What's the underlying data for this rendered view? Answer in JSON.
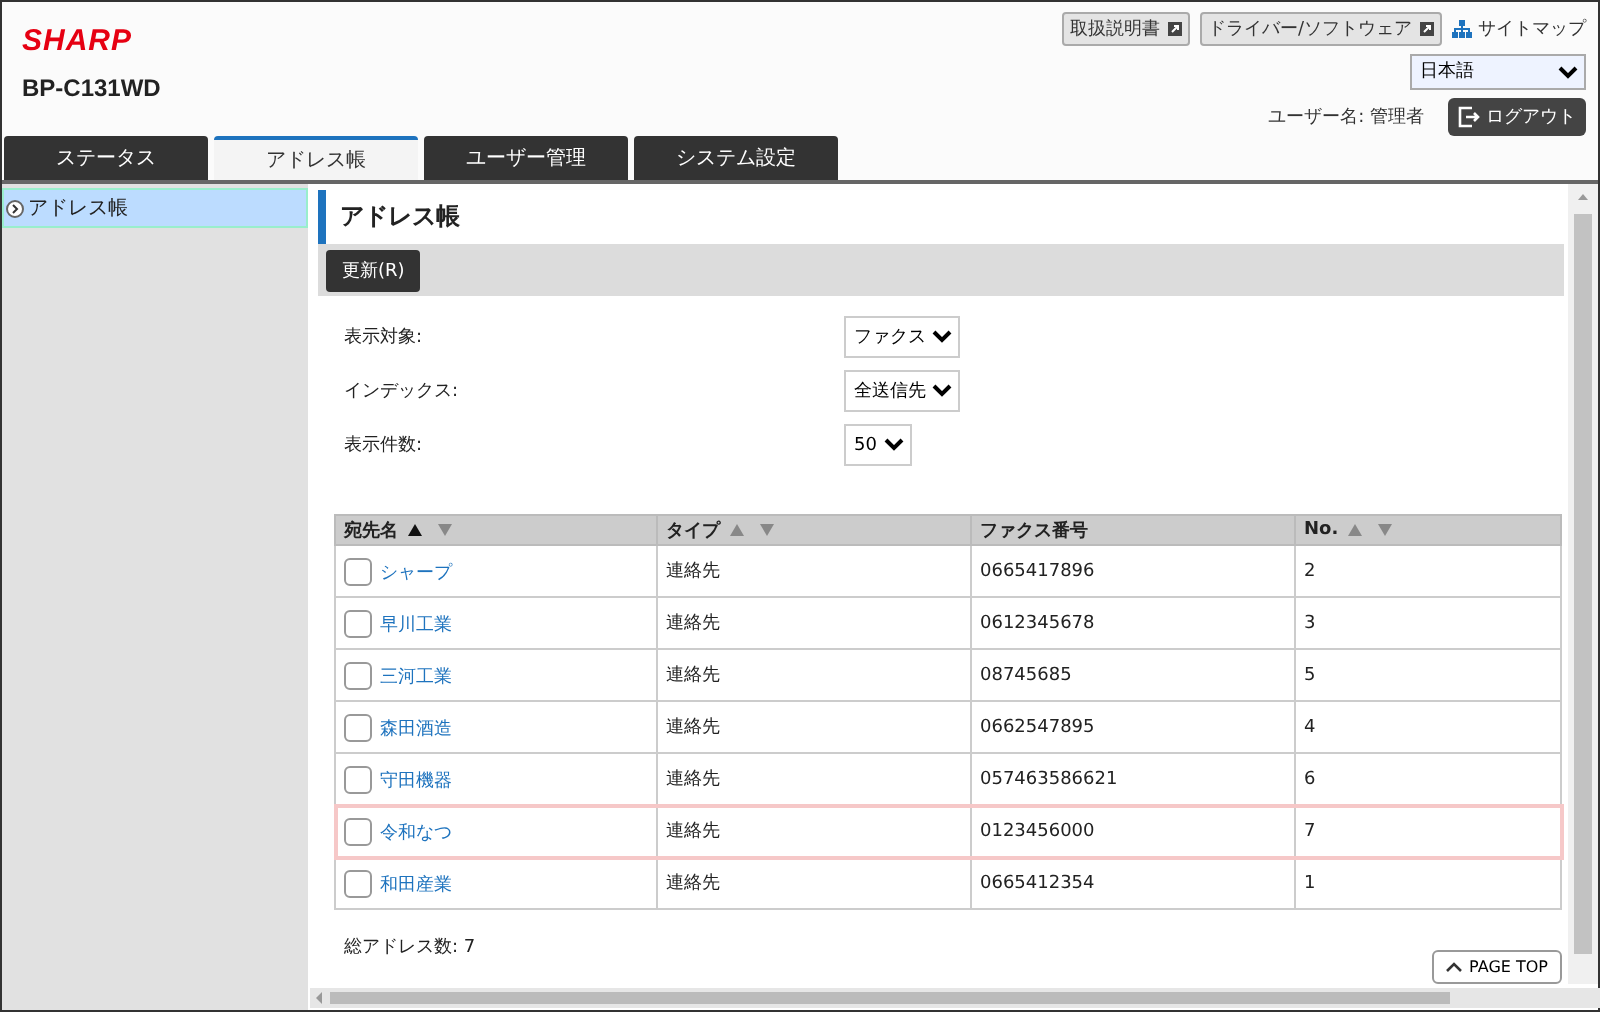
{
  "header": {
    "logo": "SHARP",
    "model": "BP-C131WD",
    "links": [
      {
        "label": "取扱説明書",
        "kind": "external"
      },
      {
        "label": "ドライバー/ソフトウェア",
        "kind": "external"
      },
      {
        "label": "サイトマップ",
        "kind": "sitemap"
      }
    ],
    "language": "日本語",
    "user_label": "ユーザー名: 管理者",
    "logout": "ログアウト"
  },
  "tabs": [
    {
      "label": "ステータス",
      "selected": false
    },
    {
      "label": "アドレス帳",
      "selected": true
    },
    {
      "label": "ユーザー管理",
      "selected": false
    },
    {
      "label": "システム設定",
      "selected": false
    }
  ],
  "sidebar": {
    "items": [
      {
        "label": "アドレス帳",
        "selected": true
      }
    ]
  },
  "page_title": "アドレス帳",
  "toolbar": {
    "buttons": [
      "更新(R)"
    ]
  },
  "filters": [
    {
      "label": "表示対象:",
      "value": "ファクス"
    },
    {
      "label": "インデックス:",
      "value": "全送信先"
    },
    {
      "label": "表示件数:",
      "value": "50"
    }
  ],
  "table": {
    "columns": [
      {
        "label": "宛先名",
        "sortable": true,
        "sorted_ascending": true
      },
      {
        "label": "タイプ",
        "sortable": true,
        "sorted_ascending": false
      },
      {
        "label": "ファクス番号",
        "sortable": false
      },
      {
        "label": "No.",
        "sortable": true,
        "sorted_ascending": false
      }
    ],
    "rows": [
      {
        "name": "シャープ",
        "type": "連絡先",
        "fax": "0665417896",
        "no": "2",
        "checked": false,
        "highlighted": false
      },
      {
        "name": "早川工業",
        "type": "連絡先",
        "fax": "0612345678",
        "no": "3",
        "checked": false,
        "highlighted": false
      },
      {
        "name": "三河工業",
        "type": "連絡先",
        "fax": "08745685",
        "no": "5",
        "checked": false,
        "highlighted": false
      },
      {
        "name": "森田酒造",
        "type": "連絡先",
        "fax": "0662547895",
        "no": "4",
        "checked": false,
        "highlighted": false
      },
      {
        "name": "守田機器",
        "type": "連絡先",
        "fax": "057463586621",
        "no": "6",
        "checked": false,
        "highlighted": false
      },
      {
        "name": "令和なつ",
        "type": "連絡先",
        "fax": "0123456000",
        "no": "7",
        "checked": false,
        "highlighted": true
      },
      {
        "name": "和田産業",
        "type": "連絡先",
        "fax": "0665412354",
        "no": "1",
        "checked": false,
        "highlighted": false
      }
    ]
  },
  "total": "総アドレス数:  7",
  "page_top": "PAGE TOP"
}
